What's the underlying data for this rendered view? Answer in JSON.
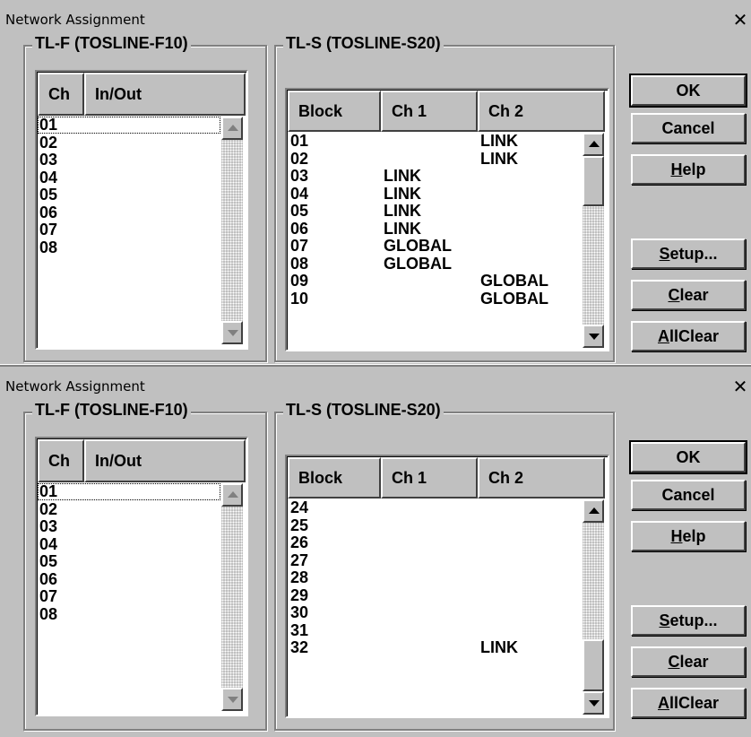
{
  "dialogs": [
    {
      "title": "Network Assignment",
      "close_glyph": "✕",
      "tlf": {
        "label": "TL-F (TOSLINE-F10)",
        "headers": [
          "Ch",
          "In/Out"
        ],
        "rows": [
          "01",
          "02",
          "03",
          "04",
          "05",
          "06",
          "07",
          "08"
        ]
      },
      "tls": {
        "label": "TL-S (TOSLINE-S20)",
        "headers": [
          "Block",
          "Ch 1",
          "Ch 2"
        ],
        "rows": [
          {
            "block": "01",
            "ch1": "",
            "ch2": "LINK"
          },
          {
            "block": "02",
            "ch1": "",
            "ch2": "LINK"
          },
          {
            "block": "03",
            "ch1": "LINK",
            "ch2": ""
          },
          {
            "block": "04",
            "ch1": "LINK",
            "ch2": ""
          },
          {
            "block": "05",
            "ch1": "LINK",
            "ch2": ""
          },
          {
            "block": "06",
            "ch1": "LINK",
            "ch2": ""
          },
          {
            "block": "07",
            "ch1": "GLOBAL",
            "ch2": ""
          },
          {
            "block": "08",
            "ch1": "GLOBAL",
            "ch2": ""
          },
          {
            "block": "09",
            "ch1": "",
            "ch2": "GLOBAL"
          },
          {
            "block": "10",
            "ch1": "",
            "ch2": "GLOBAL"
          }
        ]
      },
      "buttons": {
        "ok": "OK",
        "cancel": "Cancel",
        "help": {
          "mnemonic": "H",
          "rest": "elp"
        },
        "setup": {
          "mnemonic": "S",
          "rest": "etup..."
        },
        "clear": {
          "mnemonic": "C",
          "rest": "lear"
        },
        "allclear": {
          "mnemonic": "A",
          "rest": "llClear"
        }
      }
    },
    {
      "title": "Network Assignment",
      "close_glyph": "✕",
      "tlf": {
        "label": "TL-F (TOSLINE-F10)",
        "headers": [
          "Ch",
          "In/Out"
        ],
        "rows": [
          "01",
          "02",
          "03",
          "04",
          "05",
          "06",
          "07",
          "08"
        ]
      },
      "tls": {
        "label": "TL-S (TOSLINE-S20)",
        "headers": [
          "Block",
          "Ch 1",
          "Ch 2"
        ],
        "rows": [
          {
            "block": "24",
            "ch1": "",
            "ch2": ""
          },
          {
            "block": "25",
            "ch1": "",
            "ch2": ""
          },
          {
            "block": "26",
            "ch1": "",
            "ch2": ""
          },
          {
            "block": "27",
            "ch1": "",
            "ch2": ""
          },
          {
            "block": "28",
            "ch1": "",
            "ch2": ""
          },
          {
            "block": "29",
            "ch1": "",
            "ch2": ""
          },
          {
            "block": "30",
            "ch1": "",
            "ch2": ""
          },
          {
            "block": "31",
            "ch1": "",
            "ch2": ""
          },
          {
            "block": "32",
            "ch1": "",
            "ch2": "LINK"
          }
        ]
      },
      "buttons": {
        "ok": "OK",
        "cancel": "Cancel",
        "help": {
          "mnemonic": "H",
          "rest": "elp"
        },
        "setup": {
          "mnemonic": "S",
          "rest": "etup..."
        },
        "clear": {
          "mnemonic": "C",
          "rest": "lear"
        },
        "allclear": {
          "mnemonic": "A",
          "rest": "llClear"
        }
      }
    }
  ]
}
